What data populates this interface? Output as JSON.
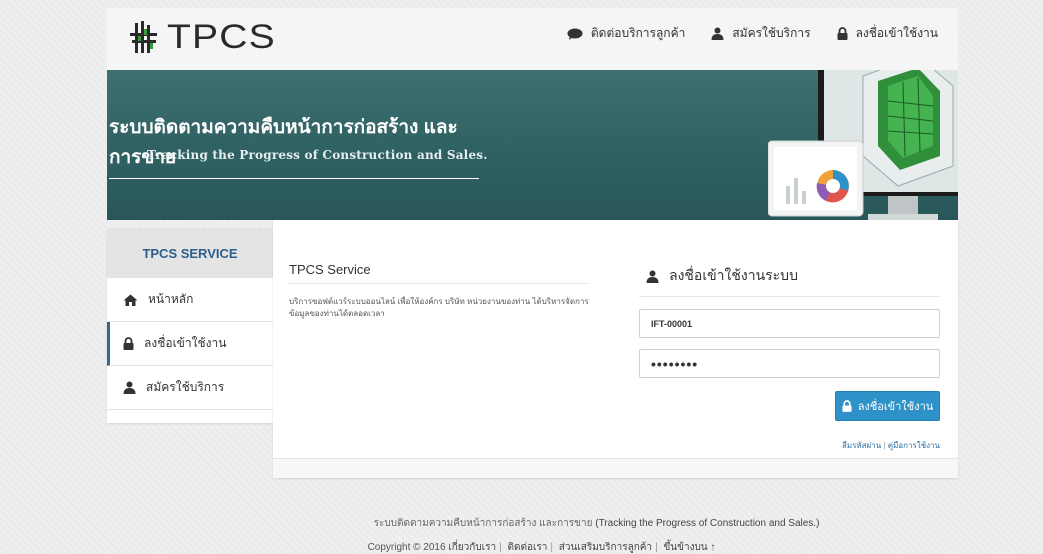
{
  "header": {
    "logo_text": "TPCS",
    "nav": [
      {
        "label": "ติดต่อบริการลูกค้า",
        "icon": "chat-bubble-icon"
      },
      {
        "label": "สมัครใช้บริการ",
        "icon": "user-icon"
      },
      {
        "label": "ลงชื่อเข้าใช้งาน",
        "icon": "lock-icon"
      }
    ]
  },
  "banner": {
    "title": "ระบบติดตามความคืบหน้าการก่อสร้าง และการขาย",
    "subtitle": "Tracking the Progress of Construction and Sales."
  },
  "sidebar": {
    "heading": "TPCS SERVICE",
    "items": [
      {
        "label": "หน้าหลัก",
        "icon": "home-icon"
      },
      {
        "label": "ลงชื่อเข้าใช้งาน",
        "icon": "lock-icon",
        "active": true
      },
      {
        "label": "สมัครใช้บริการ",
        "icon": "user-icon"
      }
    ]
  },
  "service": {
    "title": "TPCS Service",
    "description": "บริการซอฟต์แวร์ระบบออนไลน์ เพื่อให้องค์กร บริษัท หน่วยงานของท่าน ได้บริหารจัดการข้อมูลของท่านได้ตลอดเวลา"
  },
  "login": {
    "title": "ลงชื่อเข้าใช้งานระบบ",
    "username_value": "IFT-00001",
    "password_value": "••••••••",
    "button_label": "ลงชื่อเข้าใช้งาน",
    "forgot_link": "ลืมรหัสผ่าน",
    "manual_link": "คู่มือการใช้งาน",
    "link_separator": " | "
  },
  "footer": {
    "line1_th": "ระบบติดตามความคืบหน้าการก่อสร้าง และการขาย",
    "line1_en": "(Tracking the Progress of Construction and Sales.)",
    "copyright": "Copyright © 2016",
    "links": [
      "เกี่ยวกับเรา",
      "ติดต่อเรา",
      "ส่วนเสริมบริการลูกค้า",
      "ขึ้นข้างบน ↑"
    ]
  },
  "colors": {
    "banner": "#2f6163",
    "accent_blue": "#2e91c7",
    "sidebar_heading": "#2b5e8c"
  }
}
